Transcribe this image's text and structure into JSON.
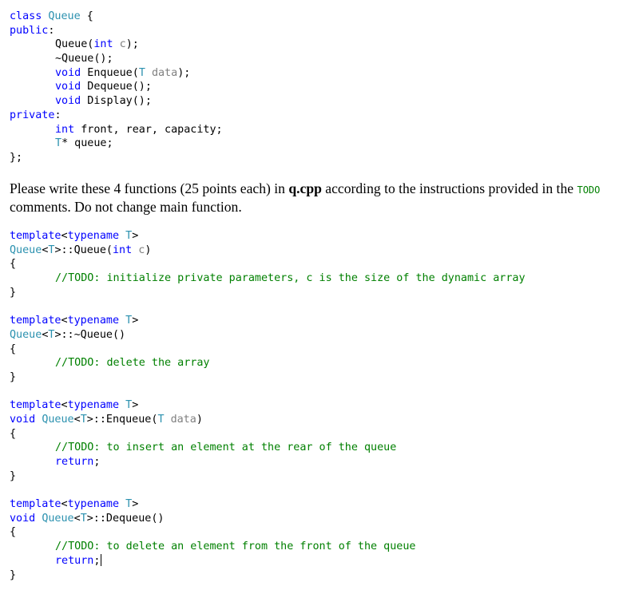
{
  "colors": {
    "keyword": "#0000ff",
    "type": "#2b91af",
    "param": "#808080",
    "comment": "#008000",
    "text": "#000000"
  },
  "class_decl": [
    {
      "indent": false,
      "tokens": [
        [
          "k",
          "class"
        ],
        [
          "n",
          " "
        ],
        [
          "t",
          "Queue"
        ],
        [
          "n",
          " {"
        ]
      ]
    },
    {
      "indent": false,
      "tokens": [
        [
          "k",
          "public"
        ],
        [
          "n",
          ":"
        ]
      ]
    },
    {
      "indent": true,
      "tokens": [
        [
          "n",
          "Queue("
        ],
        [
          "k",
          "int"
        ],
        [
          "n",
          " "
        ],
        [
          "p",
          "c"
        ],
        [
          "n",
          ");"
        ]
      ]
    },
    {
      "indent": true,
      "tokens": [
        [
          "n",
          "~Queue();"
        ]
      ]
    },
    {
      "indent": true,
      "tokens": [
        [
          "k",
          "void"
        ],
        [
          "n",
          " Enqueue("
        ],
        [
          "t",
          "T"
        ],
        [
          "n",
          " "
        ],
        [
          "p",
          "data"
        ],
        [
          "n",
          ");"
        ]
      ]
    },
    {
      "indent": true,
      "tokens": [
        [
          "k",
          "void"
        ],
        [
          "n",
          " Dequeue();"
        ]
      ]
    },
    {
      "indent": true,
      "tokens": [
        [
          "k",
          "void"
        ],
        [
          "n",
          " Display();"
        ]
      ]
    },
    {
      "indent": false,
      "tokens": [
        [
          "k",
          "private"
        ],
        [
          "n",
          ":"
        ]
      ]
    },
    {
      "indent": true,
      "tokens": [
        [
          "k",
          "int"
        ],
        [
          "n",
          " front, rear, capacity;"
        ]
      ]
    },
    {
      "indent": true,
      "tokens": [
        [
          "t",
          "T"
        ],
        [
          "n",
          "* queue;"
        ]
      ]
    },
    {
      "indent": false,
      "tokens": [
        [
          "n",
          "};"
        ]
      ]
    }
  ],
  "instructions": {
    "part1": "Please write these 4 functions (25 points each) in ",
    "filename": "q.cpp",
    "part2": " according to the instructions provided in the ",
    "todo": "TODO",
    "part3": " comments. Do not change main function."
  },
  "functions": [
    {
      "indent": false,
      "tokens": [
        [
          "k",
          "template"
        ],
        [
          "n",
          "<"
        ],
        [
          "k",
          "typename"
        ],
        [
          "n",
          " "
        ],
        [
          "t",
          "T"
        ],
        [
          "n",
          ">"
        ]
      ]
    },
    {
      "indent": false,
      "tokens": [
        [
          "t",
          "Queue"
        ],
        [
          "n",
          "<"
        ],
        [
          "t",
          "T"
        ],
        [
          "n",
          ">::Queue("
        ],
        [
          "k",
          "int"
        ],
        [
          "n",
          " "
        ],
        [
          "p",
          "c"
        ],
        [
          "n",
          ")"
        ]
      ]
    },
    {
      "indent": false,
      "tokens": [
        [
          "n",
          "{"
        ]
      ]
    },
    {
      "indent": true,
      "tokens": [
        [
          "c",
          "//TODO: initialize private parameters, c is the size of the dynamic array"
        ]
      ]
    },
    {
      "indent": false,
      "tokens": [
        [
          "n",
          "}"
        ]
      ]
    },
    {
      "indent": false,
      "tokens": []
    },
    {
      "indent": false,
      "tokens": [
        [
          "k",
          "template"
        ],
        [
          "n",
          "<"
        ],
        [
          "k",
          "typename"
        ],
        [
          "n",
          " "
        ],
        [
          "t",
          "T"
        ],
        [
          "n",
          ">"
        ]
      ]
    },
    {
      "indent": false,
      "tokens": [
        [
          "t",
          "Queue"
        ],
        [
          "n",
          "<"
        ],
        [
          "t",
          "T"
        ],
        [
          "n",
          ">::~Queue()"
        ]
      ]
    },
    {
      "indent": false,
      "tokens": [
        [
          "n",
          "{"
        ]
      ]
    },
    {
      "indent": true,
      "tokens": [
        [
          "c",
          "//TODO: delete the array"
        ]
      ]
    },
    {
      "indent": false,
      "tokens": [
        [
          "n",
          "}"
        ]
      ]
    },
    {
      "indent": false,
      "tokens": []
    },
    {
      "indent": false,
      "tokens": [
        [
          "k",
          "template"
        ],
        [
          "n",
          "<"
        ],
        [
          "k",
          "typename"
        ],
        [
          "n",
          " "
        ],
        [
          "t",
          "T"
        ],
        [
          "n",
          ">"
        ]
      ]
    },
    {
      "indent": false,
      "tokens": [
        [
          "k",
          "void"
        ],
        [
          "n",
          " "
        ],
        [
          "t",
          "Queue"
        ],
        [
          "n",
          "<"
        ],
        [
          "t",
          "T"
        ],
        [
          "n",
          ">::Enqueue("
        ],
        [
          "t",
          "T"
        ],
        [
          "n",
          " "
        ],
        [
          "p",
          "data"
        ],
        [
          "n",
          ")"
        ]
      ]
    },
    {
      "indent": false,
      "tokens": [
        [
          "n",
          "{"
        ]
      ]
    },
    {
      "indent": true,
      "tokens": [
        [
          "c",
          "//TODO: to insert an element at the rear of the queue"
        ]
      ]
    },
    {
      "indent": true,
      "tokens": [
        [
          "k",
          "return"
        ],
        [
          "n",
          ";"
        ]
      ]
    },
    {
      "indent": false,
      "tokens": [
        [
          "n",
          "}"
        ]
      ]
    },
    {
      "indent": false,
      "tokens": []
    },
    {
      "indent": false,
      "tokens": [
        [
          "k",
          "template"
        ],
        [
          "n",
          "<"
        ],
        [
          "k",
          "typename"
        ],
        [
          "n",
          " "
        ],
        [
          "t",
          "T"
        ],
        [
          "n",
          ">"
        ]
      ]
    },
    {
      "indent": false,
      "tokens": [
        [
          "k",
          "void"
        ],
        [
          "n",
          " "
        ],
        [
          "t",
          "Queue"
        ],
        [
          "n",
          "<"
        ],
        [
          "t",
          "T"
        ],
        [
          "n",
          ">::Dequeue()"
        ]
      ]
    },
    {
      "indent": false,
      "tokens": [
        [
          "n",
          "{"
        ]
      ]
    },
    {
      "indent": true,
      "tokens": [
        [
          "c",
          "//TODO: to delete an element from the front of the queue"
        ]
      ]
    },
    {
      "indent": true,
      "cursor": true,
      "tokens": [
        [
          "k",
          "return"
        ],
        [
          "n",
          ";"
        ]
      ]
    },
    {
      "indent": false,
      "tokens": [
        [
          "n",
          "}"
        ]
      ]
    }
  ]
}
